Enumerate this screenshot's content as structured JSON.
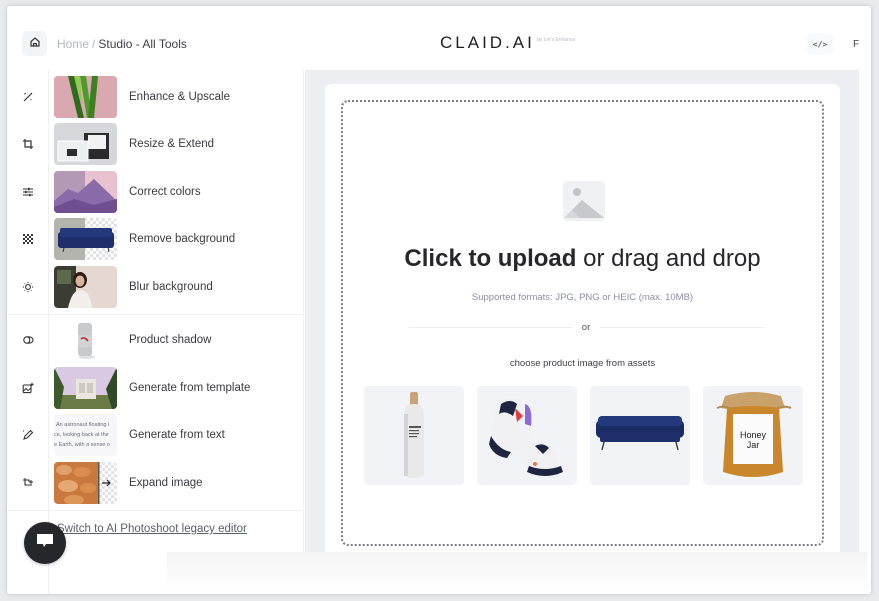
{
  "header": {
    "breadcrumb": {
      "home": "Home",
      "separator": "/",
      "current": "Studio - All Tools"
    },
    "logo": "CLAID.AI",
    "logo_tagline": "by Let's Enhance",
    "code_button": "</>",
    "partial_button": "F"
  },
  "sidebar": {
    "tools": [
      {
        "label": "Enhance & Upscale",
        "icon": "magic-wand-icon"
      },
      {
        "label": "Resize & Extend",
        "icon": "crop-icon"
      },
      {
        "label": "Correct colors",
        "icon": "sliders-icon"
      },
      {
        "label": "Remove background",
        "icon": "checkerboard-icon"
      },
      {
        "label": "Blur background",
        "icon": "sun-blur-icon"
      },
      {
        "label": "Product shadow",
        "icon": "shadow-icon"
      },
      {
        "label": "Generate from template",
        "icon": "image-plus-icon"
      },
      {
        "label": "Generate from text",
        "icon": "pen-sparkle-icon"
      },
      {
        "label": "Expand image",
        "icon": "crop-expand-icon"
      }
    ],
    "text_thumb_lines": [
      "An astronaut floating i",
      "ce, looking back at the",
      "e Earth, with a sense o"
    ],
    "legacy_link": "Switch to AI Photoshoot legacy editor"
  },
  "upload": {
    "title_bold": "Click to upload",
    "title_rest": " or drag and drop",
    "formats": "Supported formats: JPG, PNG or HEIC (max. 10MB)",
    "or": "or",
    "assets_label": "choose product image from assets",
    "assets": [
      {
        "name": "bottle"
      },
      {
        "name": "sneakers"
      },
      {
        "name": "sofa"
      },
      {
        "name": "honey-jar",
        "label_line1": "Honey",
        "label_line2": "Jar"
      }
    ]
  },
  "colors": {
    "sofa_blue": "#1e2f6b",
    "honey": "#c9862a",
    "chat_button": "#26272b"
  }
}
